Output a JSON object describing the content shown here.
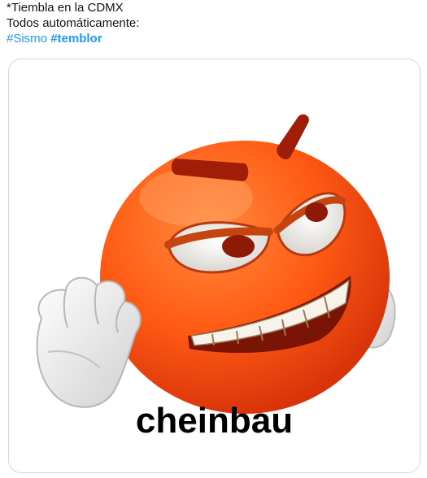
{
  "tweet": {
    "line1": "*Tiembla en la CDMX",
    "line2": "Todos automáticamente:",
    "hashtags": [
      "#Sismo",
      "#temblor"
    ]
  },
  "media": {
    "caption": "cheinbau",
    "icon": "angry-emoji-icon",
    "colors": {
      "face": "#ff5a14",
      "brow": "#a01e08",
      "hashtag": "#1d9bf0"
    }
  }
}
